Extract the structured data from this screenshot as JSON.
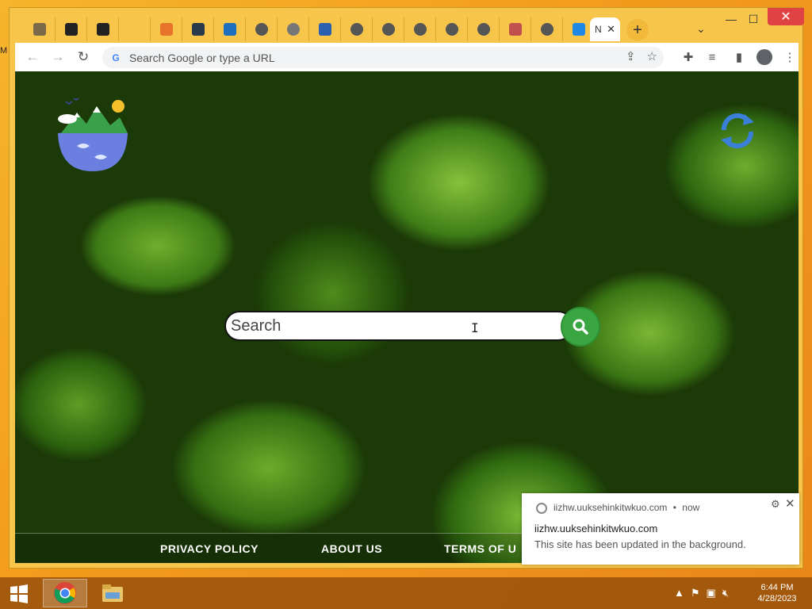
{
  "desktop": {
    "edge_text": "M"
  },
  "browser": {
    "tabs": [
      {
        "icon": "media-icon",
        "color": "#7a6a4a"
      },
      {
        "icon": "app-tile-icon",
        "color": "#222222"
      },
      {
        "icon": "skull-icon",
        "color": "#222222"
      },
      {
        "icon": "blank-icon",
        "color": "#f7c54a"
      },
      {
        "icon": "layers-icon",
        "color": "#e8732a"
      },
      {
        "icon": "terminal-icon",
        "color": "#2b3a4a"
      },
      {
        "icon": "up-badge-icon",
        "color": "#1f6fbf"
      },
      {
        "icon": "globe-icon",
        "color": "#555555"
      },
      {
        "icon": "globe-icon",
        "color": "#777777"
      },
      {
        "icon": "bird-icon",
        "color": "#2b5fb0"
      },
      {
        "icon": "globe-icon",
        "color": "#555555"
      },
      {
        "icon": "globe-icon",
        "color": "#555555"
      },
      {
        "icon": "globe-icon",
        "color": "#555555"
      },
      {
        "icon": "globe-icon",
        "color": "#555555"
      },
      {
        "icon": "globe-icon",
        "color": "#555555"
      },
      {
        "icon": "image-icon",
        "color": "#c0504d"
      },
      {
        "icon": "globe-icon",
        "color": "#555555"
      },
      {
        "icon": "bird-icon",
        "color": "#1e88e5"
      }
    ],
    "active_tab": {
      "title": "N",
      "close": "✕"
    },
    "new_tab": "+",
    "tab_menu": "⌄",
    "window_controls": {
      "minimize": "—",
      "maximize": "☐",
      "close": "✕"
    },
    "nav": {
      "back": "←",
      "forward": "→",
      "reload": "↻"
    },
    "omnibox": {
      "placeholder": "Search Google or type a URL",
      "g": "G"
    }
  },
  "page": {
    "search": {
      "placeholder": "Search"
    },
    "footer": {
      "privacy": "PRIVACY POLICY",
      "about": "ABOUT US",
      "terms": "TERMS OF U"
    }
  },
  "notification": {
    "source": "iizhw.uuksehinkitwkuo.com",
    "dot": "•",
    "time": "now",
    "title": "iizhw.uuksehinkitwkuo.com",
    "body": "This site has been updated in the background.",
    "close": "✕",
    "gear": "⚙"
  },
  "taskbar": {
    "time": "6:44 PM",
    "date": "4/28/2023"
  }
}
